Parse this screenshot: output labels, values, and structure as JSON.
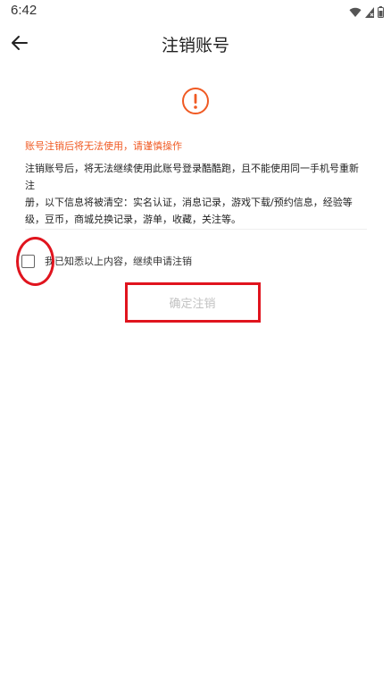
{
  "status_bar": {
    "time": "6:42",
    "icons": [
      "wifi-icon",
      "signal-icon",
      "battery-icon"
    ]
  },
  "header": {
    "back_icon": "arrow-left-icon",
    "title": "注销账号"
  },
  "notice": {
    "icon": "exclamation-circle-icon",
    "warning": "账号注销后将无法使用，请谨慎操作",
    "description_lines": [
      "注销账号后，将无法继续使用此账号登录酷酷跑，且不能使用同一手机号重新注",
      "册，以下信息将被清空：实名认证，消息记录，游戏下载/预约信息，经验等",
      "级，豆币，商城兑换记录，游单，收藏，关注等。"
    ]
  },
  "agreement": {
    "checked": false,
    "label": "我已知悉以上内容，继续申请注销"
  },
  "confirm_button": {
    "label": "确定注销",
    "enabled": false
  },
  "colors": {
    "warning": "#f05a23",
    "annotation": "#e0141e",
    "disabled_text": "#c2c2c2"
  }
}
